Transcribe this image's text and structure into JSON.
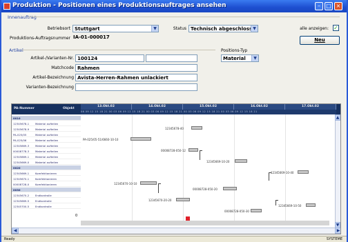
{
  "window": {
    "title": "Produktion - Positionen eines Produktionsauftrages ansehen"
  },
  "innenauftrag": {
    "section": "Innenauftrag",
    "betrieb_label": "Betriebsort",
    "betrieb_value": "Stuttgart",
    "auftragsnummer_label": "Produktions-Auftragsnummer",
    "auftragsnummer_value": "IA-01-000017",
    "status_label": "Status",
    "status_value": "Technisch abgeschlossen",
    "alle_anzeigen_label": "alle anzeigen:",
    "alle_anzeigen_checked": "✓",
    "neu_button": "Neu"
  },
  "artikel": {
    "section": "Artikel",
    "nr_label": "Artikel-/Varianten-Nr.",
    "nr_value": "100124",
    "matchcode_label": "Matchcode",
    "matchcode_value": "Rahmen",
    "bezeichnung_label": "Artikel-Bezeichnung",
    "bezeichnung_value": "Avista-Herren-Rahmen unlackiert",
    "varianten_label": "Varianten-Bezeichnung",
    "varianten_value": "",
    "positions_typ_label": "Positions-Typ",
    "positions_typ_value": "Material"
  },
  "gantt": {
    "col1": "PA-Nummer",
    "col2": "Objekt",
    "dates": [
      "13.Okt.02",
      "14.Okt.02",
      "15.Okt.02",
      "16.Okt.02",
      "17.Okt.02"
    ],
    "hours": "06 09 12 15 18 21 00 03 06 09 12 15 18 21 00 03 06 09 12 15 18 21 00 03 06 09 12 15 18 21 00 03 06 09 12 15 18 21",
    "rows": [
      {
        "c1": "0010",
        "c2": "",
        "group": true
      },
      {
        "c1": "12345678-1",
        "c2": "Material aufteilen"
      },
      {
        "c1": "12345678-9",
        "c2": "Material aufteilen"
      },
      {
        "c1": "PA-025/05",
        "c2": "Material aufteilen"
      },
      {
        "c1": "PA-025/06",
        "c2": "Material aufteilen"
      },
      {
        "c1": "12345869-3",
        "c2": "Material aufteilen"
      },
      {
        "c1": "00008778-3",
        "c2": "Material aufteilen"
      },
      {
        "c1": "12345869-1",
        "c2": "Material aufteilen"
      },
      {
        "c1": "12345669-0",
        "c2": "Material aufteilen"
      },
      {
        "c1": "0020",
        "c2": "",
        "group": true
      },
      {
        "c1": "12345669-1",
        "c2": "Komfektionieren"
      },
      {
        "c1": "12345670-1",
        "c2": "Komfektionieren"
      },
      {
        "c1": "00008728-0",
        "c2": "Komfektionieren"
      },
      {
        "c1": "0030",
        "c2": "",
        "group": true
      },
      {
        "c1": "12345670-2",
        "c2": "Endkontrolle"
      },
      {
        "c1": "12345669-5",
        "c2": "Endkontrolle"
      },
      {
        "c1": "12345700-5",
        "c2": "Endkontrolle"
      }
    ],
    "bars": [
      {
        "label": "12345678-40"
      },
      {
        "label": "PA-025/05-51/6660-10-10"
      },
      {
        "label": "00008728-050-12"
      },
      {
        "label": "12345669-10-20"
      },
      {
        "label": "12345669-10-40"
      },
      {
        "label": "12345670-10-10"
      },
      {
        "label": "00008728-050-20"
      },
      {
        "label": "12345670-20-20"
      },
      {
        "label": "12345669-10-50"
      },
      {
        "label": "00008728-050-30"
      }
    ],
    "footer_num": "0"
  },
  "statusbar": {
    "left": "Ready",
    "right": "SYSTEME"
  }
}
